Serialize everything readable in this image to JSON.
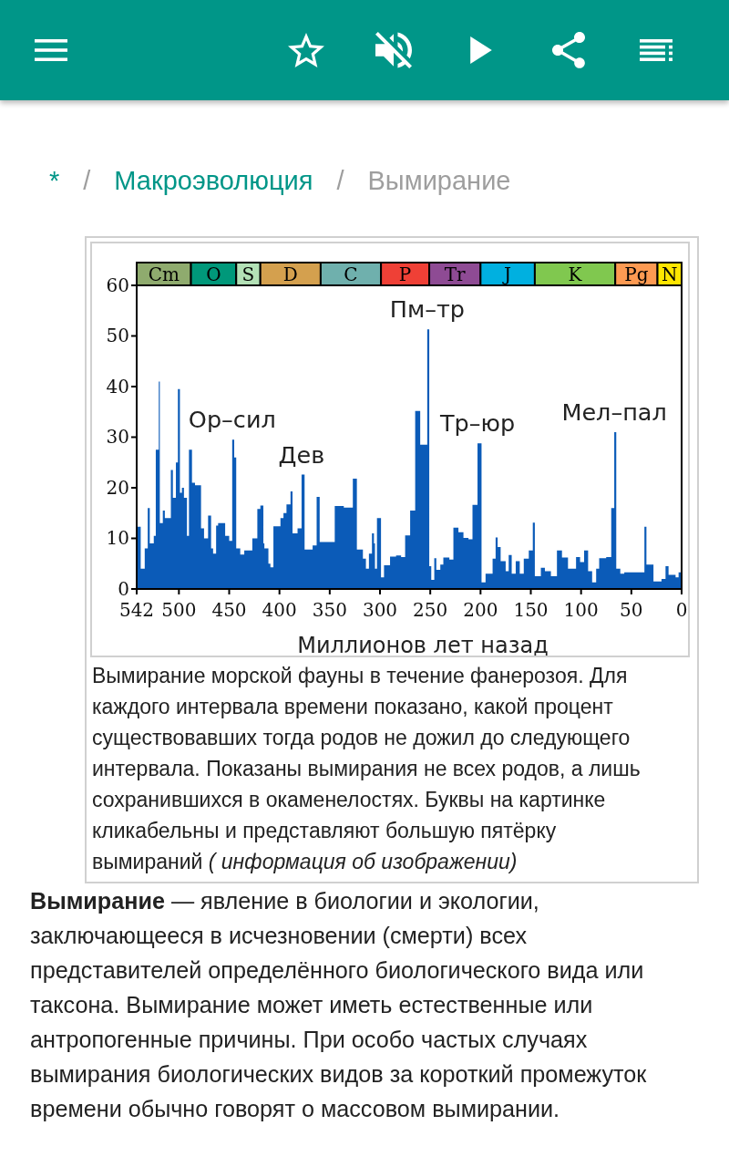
{
  "app_bar": {
    "starred": false,
    "muted": true
  },
  "breadcrumb": [
    {
      "kind": "link",
      "label": "*"
    },
    {
      "kind": "separator",
      "label": "/"
    },
    {
      "kind": "link",
      "label": "Макроэволюция"
    },
    {
      "kind": "separator",
      "label": "/"
    },
    {
      "kind": "current",
      "label": "Вымирание"
    }
  ],
  "figure": {
    "chart_data": {
      "type": "area",
      "xlabel": "Миллионов лет назад",
      "x": [
        542,
        538,
        534,
        531,
        529,
        525,
        523,
        520,
        519,
        516,
        514,
        508,
        506,
        503,
        501,
        499,
        497,
        495,
        492,
        490,
        487,
        484,
        478,
        475,
        471,
        468,
        466,
        463,
        461,
        454,
        450,
        447,
        445,
        443,
        439,
        435,
        427,
        422,
        419,
        416,
        415,
        411,
        409,
        406,
        399,
        396,
        393,
        389,
        387,
        382,
        378,
        375,
        367,
        363,
        360,
        345,
        336,
        327,
        323,
        317,
        314,
        311,
        308,
        306,
        305,
        303,
        299,
        296,
        290,
        284,
        279,
        275,
        270,
        265,
        260,
        253,
        251,
        249,
        246,
        244,
        240,
        237,
        231,
        227,
        222,
        217,
        212,
        208,
        203,
        199,
        195,
        188,
        185,
        183,
        180,
        175,
        172,
        169,
        165,
        161,
        157,
        152,
        148,
        146,
        140,
        136,
        130,
        124,
        119,
        113,
        105,
        101,
        97,
        93,
        89,
        85,
        82,
        75,
        70,
        67,
        65,
        61,
        57,
        37,
        35,
        28,
        20,
        16,
        13,
        6,
        3
      ],
      "values": [
        12.3,
        4,
        8,
        16,
        9,
        10.5,
        27.5,
        41,
        13,
        15.5,
        14,
        23.5,
        18,
        25,
        39.5,
        19,
        20,
        18,
        10.5,
        27.5,
        21,
        20.5,
        12,
        10,
        14.5,
        8,
        7,
        12.5,
        13,
        10.5,
        9.5,
        29.5,
        26,
        8,
        6.8,
        7.6,
        10,
        15.8,
        16.5,
        9,
        8,
        5,
        4.3,
        12.4,
        14,
        15,
        16.7,
        19.3,
        11,
        12,
        22.6,
        7.8,
        8.6,
        18.2,
        9.3,
        16.4,
        16.1,
        21.8,
        7.8,
        6,
        4,
        7,
        11,
        9,
        4,
        14,
        2.3,
        4.7,
        6.4,
        6.6,
        6.3,
        10.6,
        15.5,
        35.2,
        28.5,
        51.3,
        4.5,
        1.8,
        6.1,
        3.8,
        4.8,
        6.2,
        5.8,
        12.1,
        11.2,
        10.1,
        9.8,
        16.6,
        28.8,
        1.3,
        3,
        6,
        10.2,
        8.3,
        5.5,
        3.5,
        6.7,
        3,
        5.5,
        3,
        6,
        7.6,
        13.1,
        2.5,
        4.2,
        3.5,
        2.5,
        7.6,
        6.2,
        4,
        6.3,
        5.3,
        7.6,
        3.5,
        1.3,
        4,
        6.1,
        6.3,
        16,
        31,
        4,
        3,
        3.3,
        12.3,
        4.8,
        1.5,
        2,
        4.5,
        2.8,
        2.3,
        3.3
      ],
      "xlim": [
        542,
        0
      ],
      "ylim": [
        0,
        64.5
      ],
      "xticks": [
        542,
        500,
        450,
        400,
        350,
        300,
        250,
        200,
        150,
        100,
        50,
        0
      ],
      "yticks": [
        0,
        10,
        20,
        30,
        40,
        50,
        60
      ],
      "bands": [
        {
          "axis": "x",
          "label": "Cm",
          "from": 542,
          "to": 488,
          "color": "#8fab6e"
        },
        {
          "axis": "x",
          "label": "O",
          "from": 488,
          "to": 443,
          "color": "#00987a"
        },
        {
          "axis": "x",
          "label": "S",
          "from": 443,
          "to": 419,
          "color": "#b3e1b6"
        },
        {
          "axis": "x",
          "label": "D",
          "from": 419,
          "to": 359,
          "color": "#d4a04e"
        },
        {
          "axis": "x",
          "label": "C",
          "from": 359,
          "to": 299,
          "color": "#6fb0ad"
        },
        {
          "axis": "x",
          "label": "P",
          "from": 299,
          "to": 251,
          "color": "#ef4036"
        },
        {
          "axis": "x",
          "label": "Tr",
          "from": 251,
          "to": 200,
          "color": "#8e4b94"
        },
        {
          "axis": "x",
          "label": "J",
          "from": 200,
          "to": 146,
          "color": "#00b0e0"
        },
        {
          "axis": "x",
          "label": "K",
          "from": 146,
          "to": 66,
          "color": "#80c84f"
        },
        {
          "axis": "x",
          "label": "Pg",
          "from": 66,
          "to": 24,
          "color": "#fd9a52"
        },
        {
          "axis": "x",
          "label": "N",
          "from": 24,
          "to": 0,
          "color": "#ffe600"
        }
      ],
      "annotations": [
        {
          "text": "Ор–сил",
          "x": 447,
          "y": 29.5
        },
        {
          "text": "Дев",
          "x": 378,
          "y": 22.6
        },
        {
          "text": "Пм–тр",
          "x": 253,
          "y": 51.3
        },
        {
          "text": "Тр–юр",
          "x": 203,
          "y": 28.8
        },
        {
          "text": "Мел–пал",
          "x": 67,
          "y": 31
        }
      ]
    },
    "caption": "Вымирание морской фауны в течение фанерозоя. Для каждого интервала времени показано, какой процент существовавших тогда родов не дожил до следующего интервала. Показаны вымирания не всех родов, а лишь сохранившихся в окаменелостях. Буквы на картинке кликабельны и представляют большую пятёрку вымираний *( информация об изображении)*"
  },
  "article": {
    "paragraph": "**Вымирание** — явление в биологии и экологии, заключающееся в исчезновении (смерти) всех представителей определённого биологического вида или таксона. Вымирание может иметь естественные или антропогенные причины. При особо частых случаях вымирания биологических видов за короткий промежуток времени обычно говорят о массовом вымирании."
  }
}
